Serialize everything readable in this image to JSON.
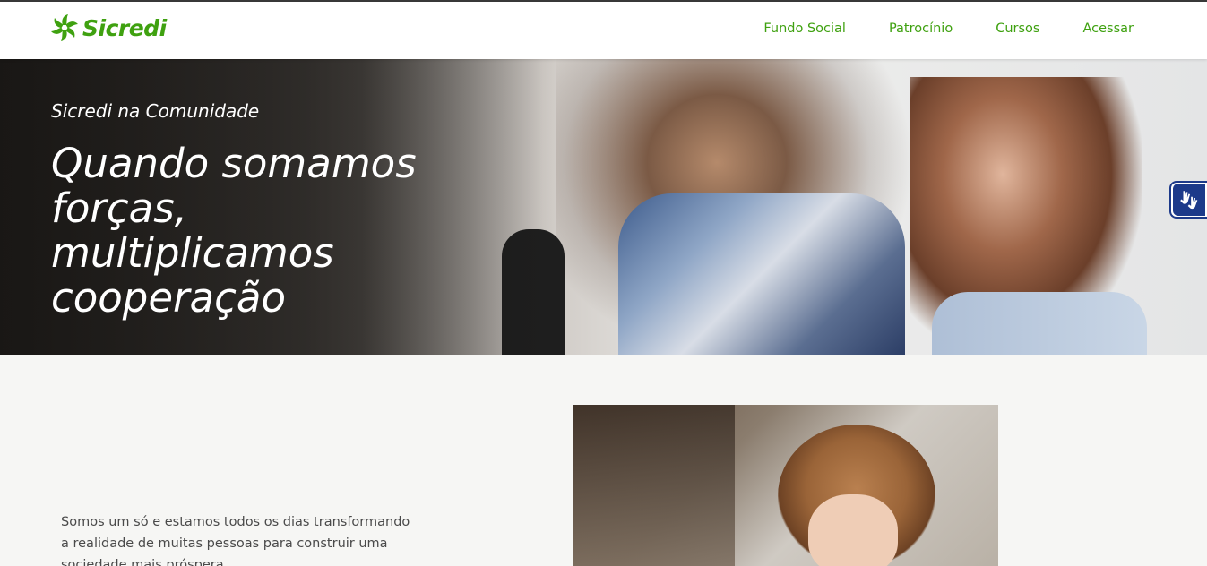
{
  "header": {
    "logo_text": "Sicredi",
    "nav": [
      {
        "label": "Fundo Social"
      },
      {
        "label": "Patrocínio"
      },
      {
        "label": "Cursos"
      },
      {
        "label": "Acessar"
      }
    ]
  },
  "hero": {
    "kicker": "Sicredi na Comunidade",
    "title": "Quando somamos forças, multiplicamos cooperação"
  },
  "accessibility": {
    "icon": "sign-language-hands-icon"
  },
  "intro": {
    "text": "Somos um só e estamos todos os dias transformando a realidade de muitas pessoas para construir uma sociedade mais próspera."
  },
  "colors": {
    "brand_green": "#3fa110",
    "accessibility_blue": "#1d3a8a",
    "page_background": "#f6f6f4"
  }
}
